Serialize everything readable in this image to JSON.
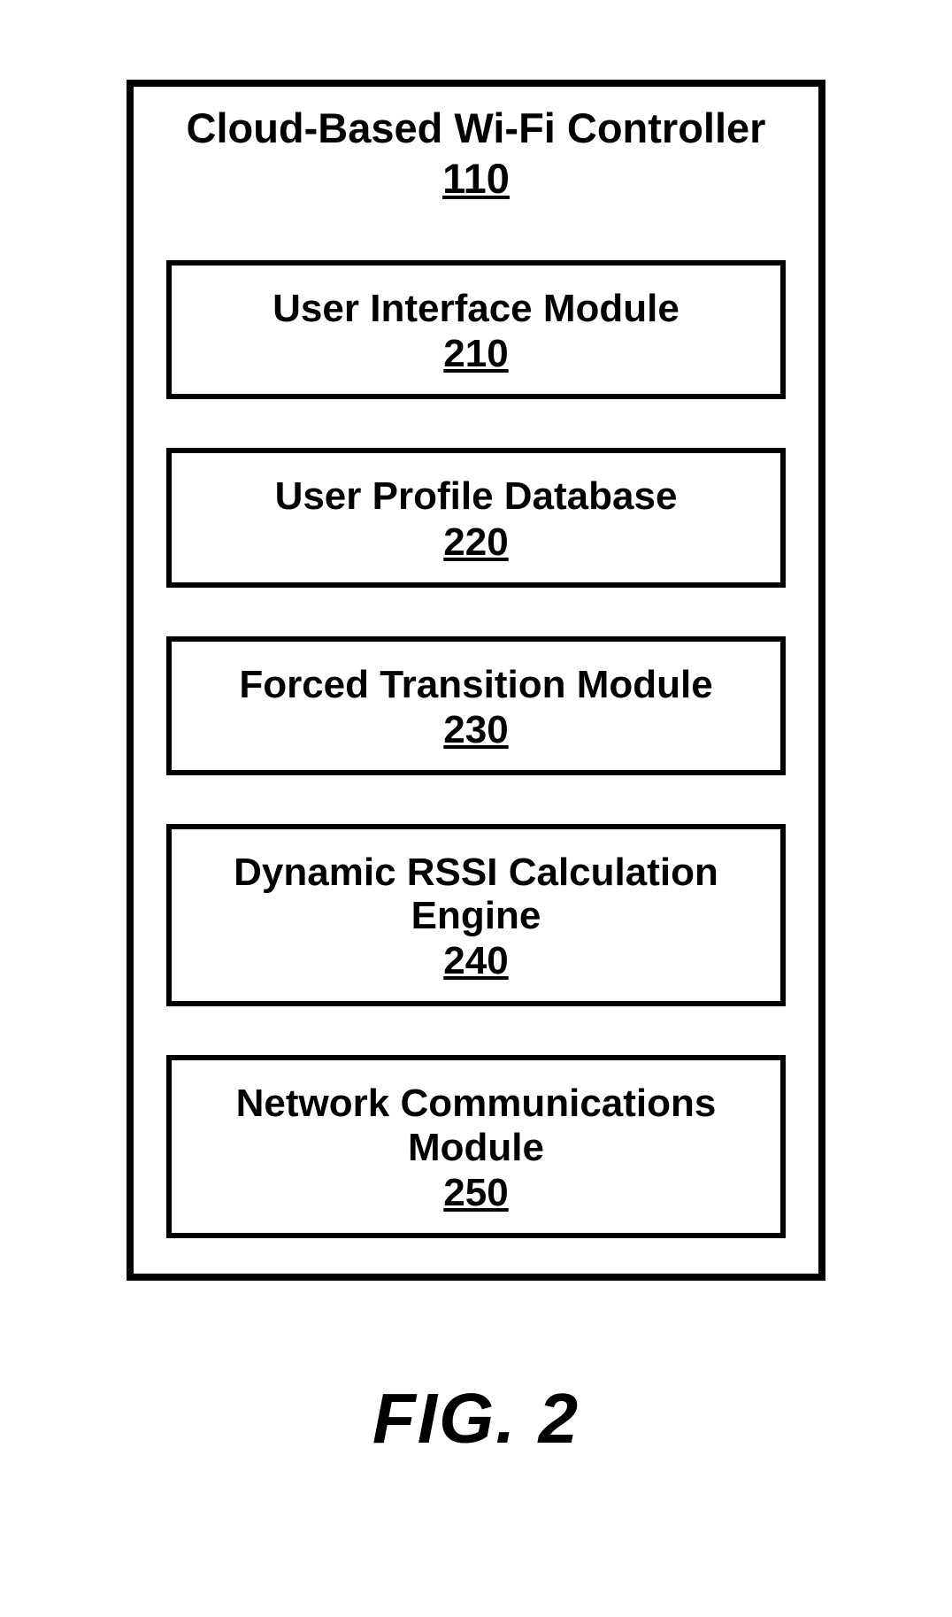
{
  "figure": {
    "caption": "FIG. 2",
    "container": {
      "title": "Cloud-Based Wi-Fi Controller",
      "ref": "110"
    },
    "modules": [
      {
        "label": "User Interface Module",
        "ref": "210"
      },
      {
        "label": "User Profile Database",
        "ref": "220"
      },
      {
        "label": "Forced Transition Module",
        "ref": "230"
      },
      {
        "label": "Dynamic RSSI Calculation Engine",
        "ref": "240"
      },
      {
        "label": "Network Communications Module",
        "ref": "250"
      }
    ]
  }
}
